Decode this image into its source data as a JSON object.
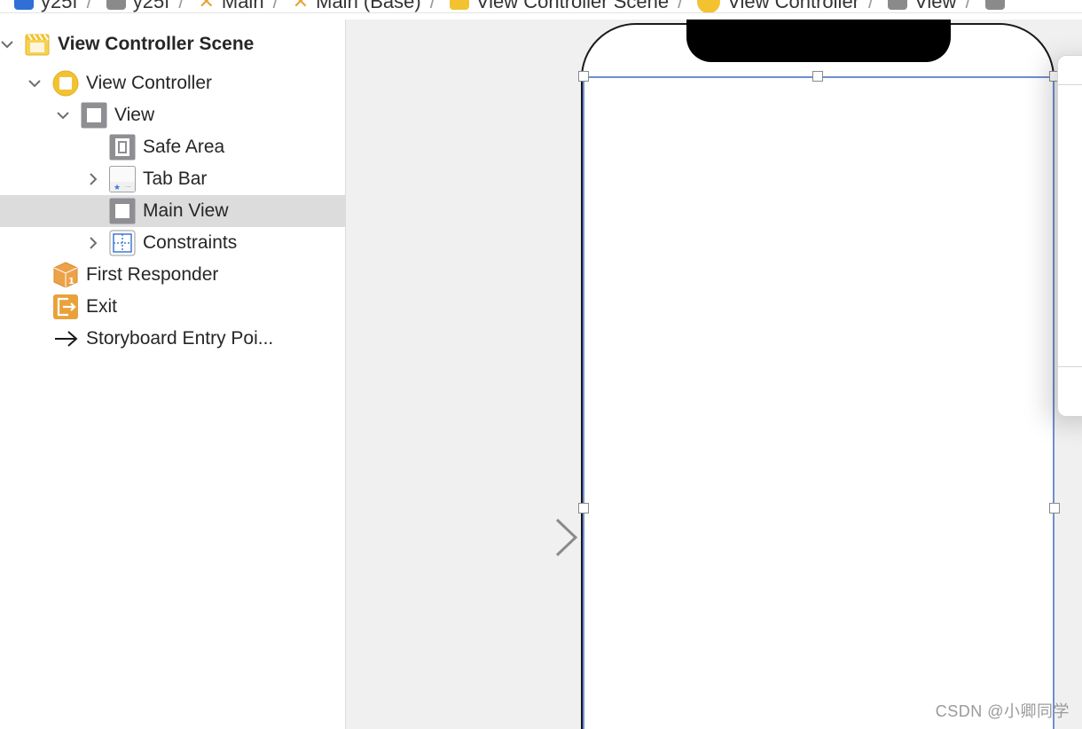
{
  "breadcrumb": {
    "items": [
      {
        "label": "y25f",
        "icon": "project-icon",
        "color": "#2f6fd6"
      },
      {
        "label": "y25f",
        "icon": "folder-icon",
        "color": "#8a8a8a"
      },
      {
        "label": "Main",
        "icon": "storyboard-icon",
        "color": "#e5a43a"
      },
      {
        "label": "Main (Base)",
        "icon": "storyboard-icon",
        "color": "#e5a43a"
      },
      {
        "label": "View Controller Scene",
        "icon": "scene-icon",
        "color": "#f2c230"
      },
      {
        "label": "View Controller",
        "icon": "view-controller-icon",
        "color": "#f2c230"
      },
      {
        "label": "View",
        "icon": "view-icon",
        "color": "#8a8a8a"
      },
      {
        "label": "",
        "icon": "view-icon",
        "color": "#8a8a8a"
      }
    ],
    "separator": "/"
  },
  "outline": {
    "rows": [
      {
        "label": "View Controller Scene",
        "icon": "scene-icon",
        "disclosure": "expanded"
      },
      {
        "label": "View Controller",
        "icon": "view-controller-icon",
        "disclosure": "expanded"
      },
      {
        "label": "View",
        "icon": "view-icon",
        "disclosure": "expanded"
      },
      {
        "label": "Safe Area",
        "icon": "safe-area-icon",
        "disclosure": "none"
      },
      {
        "label": "Tab Bar",
        "icon": "tab-bar-icon",
        "disclosure": "collapsed"
      },
      {
        "label": "Main View",
        "icon": "view-icon",
        "disclosure": "none",
        "selected": true
      },
      {
        "label": "Constraints",
        "icon": "constraints-icon",
        "disclosure": "collapsed"
      },
      {
        "label": "First Responder",
        "icon": "first-responder-icon",
        "disclosure": "none"
      },
      {
        "label": "Exit",
        "icon": "exit-icon",
        "disclosure": "none"
      },
      {
        "label": "Storyboard Entry Poi...",
        "icon": "entry-point-arrow-icon",
        "disclosure": "none"
      }
    ]
  },
  "canvas": {
    "device": "iPhone frame with notch",
    "selection": "Main View"
  },
  "watermark": "CSDN @小卿同学",
  "colors": {
    "selection_row": "#dcdcdc",
    "selection_frame": "#6f8fd0",
    "canvas_bg": "#f0f0f0",
    "scene_yellow": "#f2c230",
    "exit_orange": "#e9a23b",
    "constraints_blue": "#3f78d6"
  }
}
